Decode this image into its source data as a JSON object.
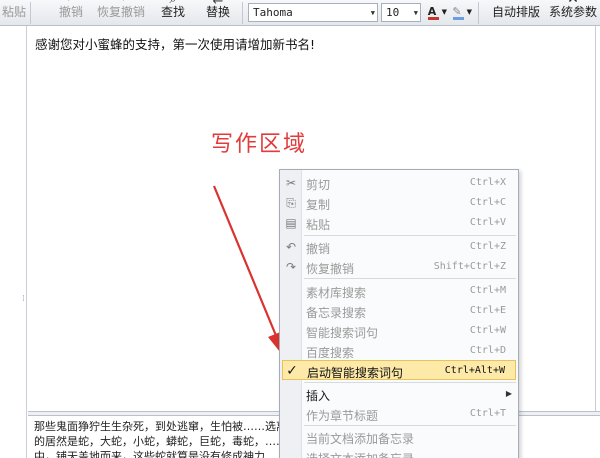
{
  "toolbar": {
    "paste_label": "粘贴",
    "undo_label": "撤销",
    "redo_label": "恢复撤销",
    "find_label": "查找",
    "replace_label": "替换",
    "font_name": "Tahoma",
    "font_size": "10",
    "text_color_glyph": "A",
    "text_color": "#c0392b",
    "highlight_color": "#6a9ee0",
    "auto_format_label": "自动排版",
    "system_params_label": "系统参数"
  },
  "editor": {
    "welcome_line": "感谢您对小蜜蜂的支持，第一次使用请增加新书名!"
  },
  "lower_pane": {
    "line1": "那些鬼面狰狞生生杂死，到处逃窜，生怕被……选离，紧接着不",
    "line2": "的居然是蛇，大蛇，小蛇，蟒蛇，巨蛇，毒蛇，……们抗外面的山野之",
    "line3": "中，铺天盖地而来，这些蛇就算是没有修成神力……"
  },
  "annotation": {
    "text": "写作区域",
    "color": "#e23b3b"
  },
  "context_menu": {
    "items": [
      {
        "icon": "scissors-icon",
        "glyph": "✂",
        "label": "剪切",
        "shortcut": "Ctrl+X"
      },
      {
        "icon": "copy-icon",
        "glyph": "⎘",
        "label": "复制",
        "shortcut": "Ctrl+C"
      },
      {
        "icon": "paste-icon",
        "glyph": "▤",
        "label": "粘贴",
        "shortcut": "Ctrl+V"
      },
      {
        "icon": "undo-icon",
        "glyph": "↶",
        "label": "撤销",
        "shortcut": "Ctrl+Z"
      },
      {
        "icon": "redo-icon",
        "glyph": "↷",
        "label": "恢复撤销",
        "shortcut": "Shift+Ctrl+Z"
      },
      {
        "label": "素材库搜索",
        "shortcut": "Ctrl+M"
      },
      {
        "label": "备忘录搜索",
        "shortcut": "Ctrl+E"
      },
      {
        "label": "智能搜索词句",
        "shortcut": "Ctrl+W"
      },
      {
        "label": "百度搜索",
        "shortcut": "Ctrl+D"
      },
      {
        "icon": "check-icon",
        "glyph": "✓",
        "label": "启动智能搜索词句",
        "shortcut": "Ctrl+Alt+W"
      },
      {
        "label": "插入"
      },
      {
        "label": "作为章节标题",
        "shortcut": "Ctrl+T"
      },
      {
        "label": "当前文档添加备忘录"
      },
      {
        "label": "选择文本添加备忘录"
      }
    ]
  }
}
